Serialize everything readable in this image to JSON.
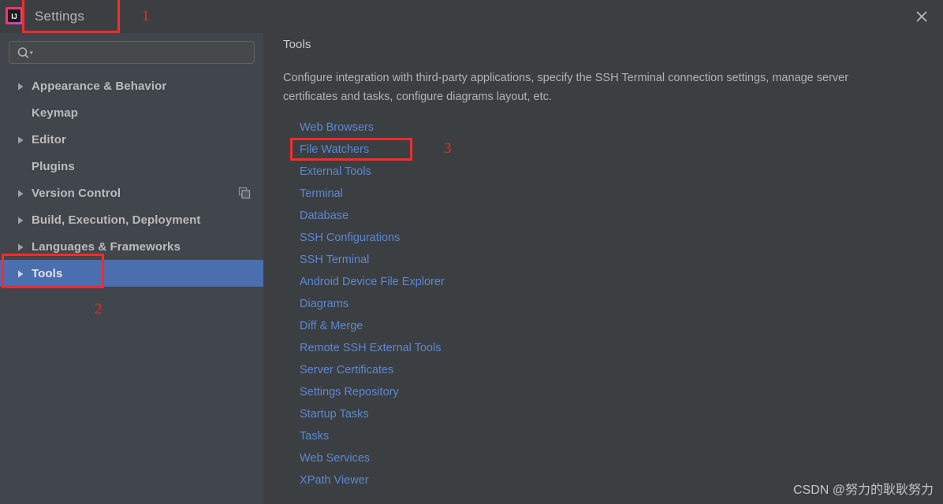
{
  "window": {
    "title": "Settings",
    "app_icon": "intellij-idea-logo",
    "close_icon": "close-icon"
  },
  "sidebar": {
    "search": {
      "value": "",
      "placeholder": "",
      "icon": "search-icon",
      "dropdown_icon": "chevron-down-icon"
    },
    "items": [
      {
        "label": "Appearance & Behavior",
        "expandable": true,
        "selected": false,
        "trailing_icon": ""
      },
      {
        "label": "Keymap",
        "expandable": false,
        "selected": false,
        "trailing_icon": ""
      },
      {
        "label": "Editor",
        "expandable": true,
        "selected": false,
        "trailing_icon": ""
      },
      {
        "label": "Plugins",
        "expandable": false,
        "selected": false,
        "trailing_icon": ""
      },
      {
        "label": "Version Control",
        "expandable": true,
        "selected": false,
        "trailing_icon": "copy-icon"
      },
      {
        "label": "Build, Execution, Deployment",
        "expandable": true,
        "selected": false,
        "trailing_icon": ""
      },
      {
        "label": "Languages & Frameworks",
        "expandable": true,
        "selected": false,
        "trailing_icon": ""
      },
      {
        "label": "Tools",
        "expandable": true,
        "selected": true,
        "trailing_icon": ""
      }
    ]
  },
  "main": {
    "title": "Tools",
    "description": "Configure integration with third-party applications, specify the SSH Terminal connection settings, manage server certificates and tasks, configure diagrams layout, etc.",
    "links": [
      "Web Browsers",
      "File Watchers",
      "External Tools",
      "Terminal",
      "Database",
      "SSH Configurations",
      "SSH Terminal",
      "Android Device File Explorer",
      "Diagrams",
      "Diff & Merge",
      "Remote SSH External Tools",
      "Server Certificates",
      "Settings Repository",
      "Startup Tasks",
      "Tasks",
      "Web Services",
      "XPath Viewer"
    ]
  },
  "annotations": {
    "step1": "1",
    "step2": "2",
    "step3": "3"
  },
  "watermark": "CSDN @努力的耿耿努力",
  "colors": {
    "window_bg": "#3c3f41",
    "sidebar_bg": "#41454c",
    "selection_blue": "#4b6eaf",
    "link_blue": "#5a87d6",
    "annotation_red": "#fa2a29",
    "text_primary": "#bbbbbb"
  }
}
